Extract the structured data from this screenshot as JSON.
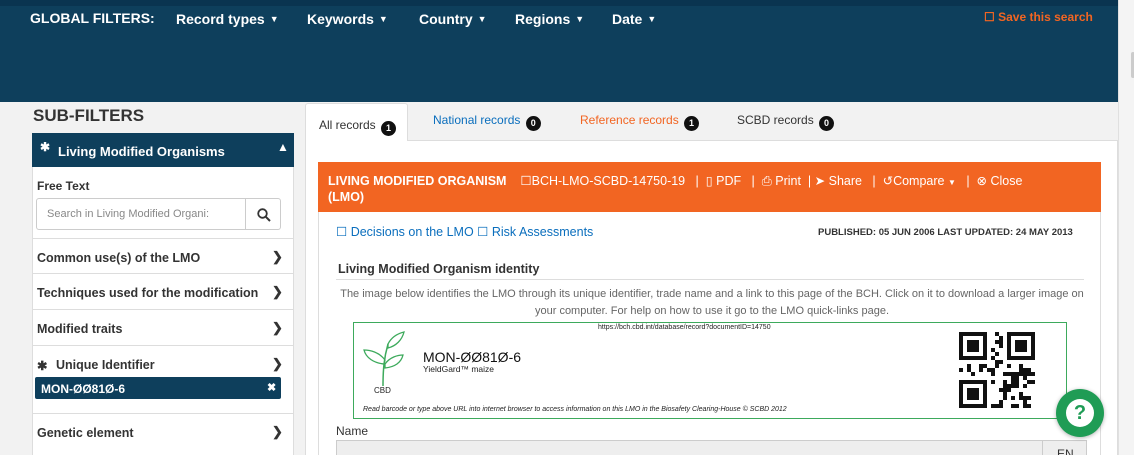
{
  "global_filters": {
    "label": "GLOBAL FILTERS:",
    "items": [
      {
        "label": "Record types"
      },
      {
        "label": "Keywords"
      },
      {
        "label": "Country"
      },
      {
        "label": "Regions"
      },
      {
        "label": "Date"
      }
    ],
    "save_label": "Save this search"
  },
  "sidebar": {
    "title": "SUB-FILTERS",
    "section": {
      "label": "Living Modified Organisms"
    },
    "free_text": {
      "label": "Free Text",
      "placeholder": "Search in Living Modified Organi:"
    },
    "rows": [
      {
        "label": "Common use(s) of the LMO"
      },
      {
        "label": "Techniques used for the modification"
      },
      {
        "label": "Modified traits"
      },
      {
        "label": "Unique Identifier"
      },
      {
        "label": "Genetic element"
      }
    ],
    "selected_tag": "MON-ØØ81Ø-6"
  },
  "tabs": [
    {
      "label": "All records",
      "count": "1"
    },
    {
      "label": "National records",
      "count": "0"
    },
    {
      "label": "Reference records",
      "count": "1"
    },
    {
      "label": "SCBD records",
      "count": "0"
    }
  ],
  "record": {
    "type": "LIVING MODIFIED ORGANISM",
    "type_suffix": "(LMO)",
    "id": "BCH-LMO-SCBD-14750-19",
    "actions": {
      "pdf": "PDF",
      "print": "Print",
      "share": "Share",
      "compare": "Compare",
      "close": "Close"
    },
    "links": {
      "decisions": "Decisions on the LMO",
      "risk": "Risk Assessments"
    },
    "published": "PUBLISHED: 05 JUN 2006 LAST UPDATED: 24 MAY 2013",
    "section_title": "Living Modified Organism identity",
    "section_desc": "The image below identifies the LMO through its unique identifier, trade name and a link to this page of the BCH. Click on it to download a larger image on your computer. For help on how to use it go to the LMO quick-links page.",
    "quicklink": {
      "url": "https://bch.cbd.int/database/record?documentID=14750",
      "identifier": "MON-ØØ81Ø-6",
      "name": "YieldGard™ maize",
      "logo_text": "CBD",
      "footer": "Read barcode or type above URL into internet browser to access information on this LMO in the Biosafety Clearing-House © SCBD 2012"
    },
    "name_label": "Name",
    "lang_button": "EN"
  },
  "colors": {
    "navy": "#0e3f5c",
    "orange": "#f26522",
    "green": "#3daa5c",
    "link": "#0a6ebd"
  }
}
